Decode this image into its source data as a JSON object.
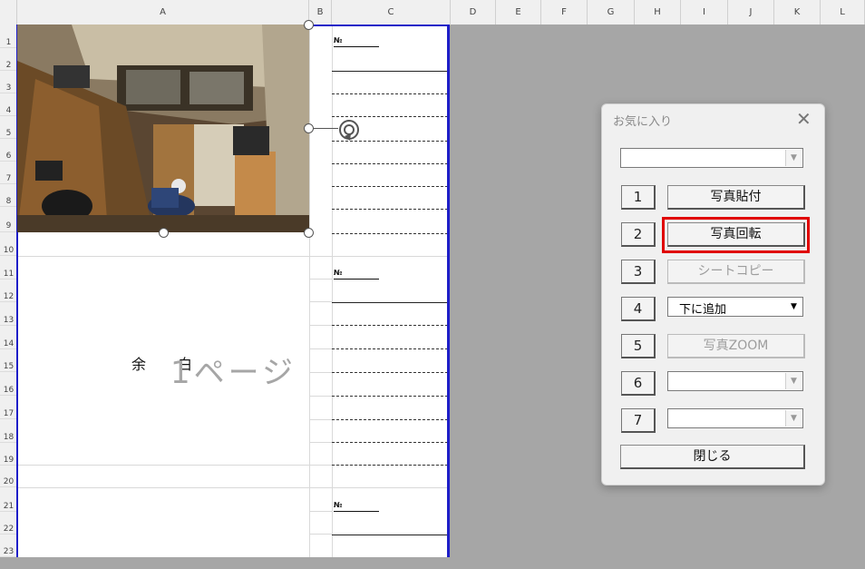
{
  "spreadsheet": {
    "columns": [
      "A",
      "B",
      "C",
      "D",
      "E",
      "F",
      "G",
      "H",
      "I",
      "J",
      "K",
      "L"
    ],
    "rows": [
      "1",
      "2",
      "3",
      "4",
      "5",
      "6",
      "7",
      "8",
      "9",
      "10",
      "11",
      "12",
      "13",
      "14",
      "15",
      "16",
      "17",
      "18",
      "19",
      "20",
      "21",
      "22",
      "23"
    ],
    "no_labels": [
      "№",
      "№",
      "№"
    ],
    "yohaku_1": "余",
    "yohaku_2": "白",
    "page_watermark": "1ページ"
  },
  "dialog": {
    "title": "お気に入り",
    "top_combo_value": "",
    "buttons": [
      {
        "num": "1",
        "label": "写真貼付",
        "enabled": true
      },
      {
        "num": "2",
        "label": "写真回転",
        "enabled": true,
        "highlighted": true
      },
      {
        "num": "3",
        "label": "シートコピー",
        "enabled": false
      },
      {
        "num": "4",
        "label": "下に追加",
        "type": "combo"
      },
      {
        "num": "5",
        "label": "写真ZOOM",
        "enabled": false
      },
      {
        "num": "6",
        "label": "",
        "type": "combo"
      },
      {
        "num": "7",
        "label": "",
        "type": "combo"
      }
    ],
    "close_label": "閉じる"
  },
  "colors": {
    "highlight": "#e00000",
    "print_border": "#1e1ec8"
  }
}
